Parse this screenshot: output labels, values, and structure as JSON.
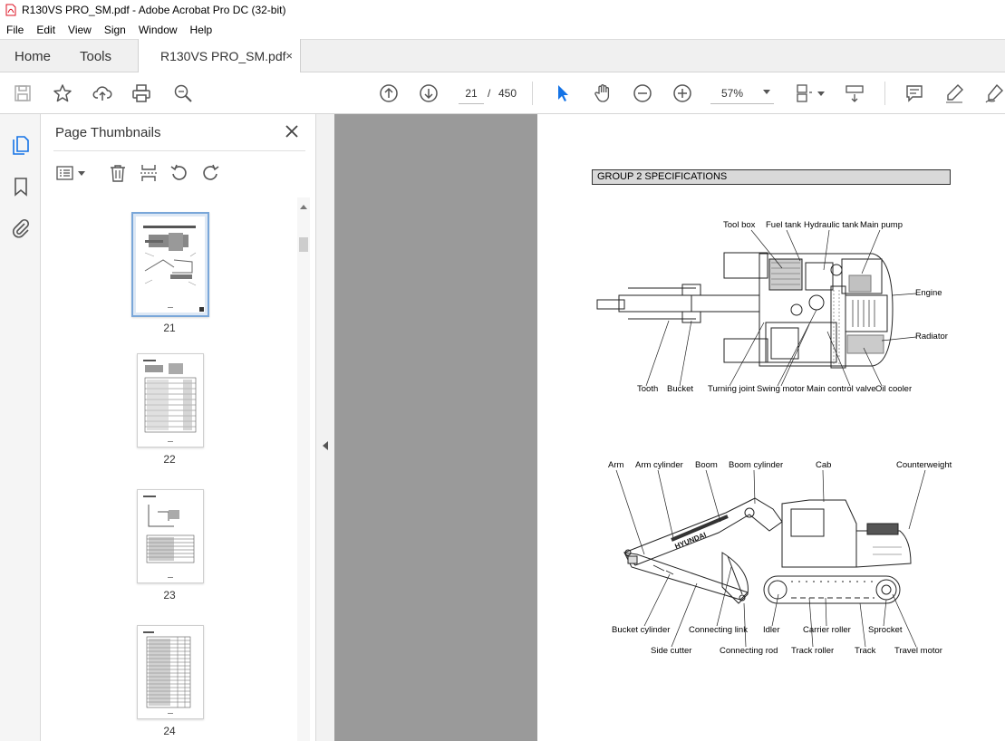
{
  "window": {
    "title": "R130VS PRO_SM.pdf - Adobe Acrobat Pro DC (32-bit)"
  },
  "menu": [
    "File",
    "Edit",
    "View",
    "Sign",
    "Window",
    "Help"
  ],
  "tabs": {
    "home": "Home",
    "tools": "Tools",
    "document": "R130VS PRO_SM.pdf",
    "close": "×"
  },
  "toolbar": {
    "current_page": "21",
    "separator": "/",
    "total_pages": "450",
    "zoom": "57%"
  },
  "panel": {
    "title": "Page Thumbnails",
    "thumbnails": [
      {
        "label": "21"
      },
      {
        "label": "22"
      },
      {
        "label": "23"
      },
      {
        "label": "24"
      }
    ]
  },
  "page": {
    "header": "GROUP  2  SPECIFICATIONS",
    "top_view_labels": {
      "tool_box": "Tool box",
      "fuel_tank": "Fuel tank",
      "hydraulic_tank": "Hydraulic tank",
      "main_pump": "Main pump",
      "engine": "Engine",
      "radiator": "Radiator",
      "tooth": "Tooth",
      "bucket": "Bucket",
      "turning_joint": "Turning joint",
      "swing_motor": "Swing motor",
      "main_control_valve": "Main control valve",
      "oil_cooler": "Oil cooler"
    },
    "side_view_labels": {
      "arm": "Arm",
      "arm_cylinder": "Arm cylinder",
      "boom": "Boom",
      "boom_cylinder": "Boom cylinder",
      "cab": "Cab",
      "counterweight": "Counterweight",
      "bucket_cylinder": "Bucket cylinder",
      "connecting_link": "Connecting link",
      "idler": "Idler",
      "carrier_roller": "Carrier roller",
      "sprocket": "Sprocket",
      "side_cutter": "Side cutter",
      "connecting_rod": "Connecting rod",
      "track_roller": "Track roller",
      "track": "Track",
      "travel_motor": "Travel motor"
    },
    "boom_text": "HYUNDAI"
  }
}
